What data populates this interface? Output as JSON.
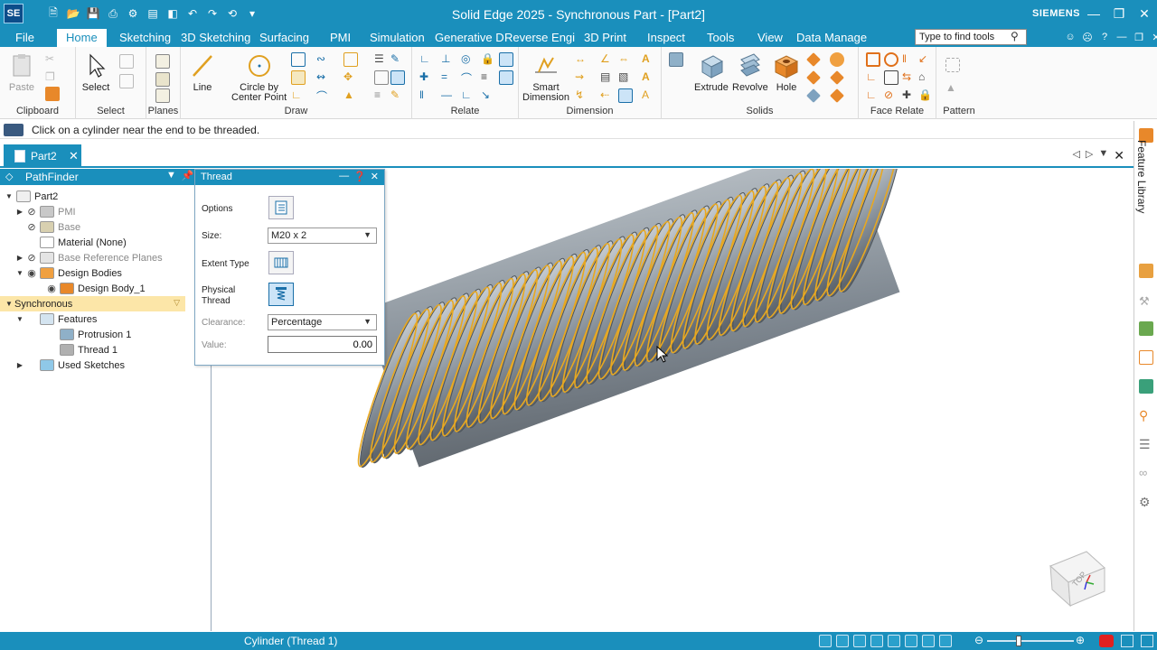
{
  "app": {
    "logo": "SE",
    "title": "Solid Edge 2025 - Synchronous Part - [Part2]",
    "brand": "SIEMENS"
  },
  "menu": {
    "items": [
      {
        "label": "File"
      },
      {
        "label": "Home",
        "active": true
      },
      {
        "label": "Sketching"
      },
      {
        "label": "3D Sketching"
      },
      {
        "label": "Surfacing"
      },
      {
        "label": "PMI"
      },
      {
        "label": "Simulation"
      },
      {
        "label": "Generative D"
      },
      {
        "label": "Reverse Engi"
      },
      {
        "label": "3D Print"
      },
      {
        "label": "Inspect"
      },
      {
        "label": "Tools"
      },
      {
        "label": "View"
      },
      {
        "label": "Data Manage"
      }
    ],
    "search_placeholder": "Type to find tools"
  },
  "ribbon": {
    "groups": {
      "clipboard": "Clipboard",
      "select": "Select",
      "planes": "Planes",
      "draw": "Draw",
      "relate": "Relate",
      "dimension": "Dimension",
      "solids": "Solids",
      "face_relate": "Face Relate",
      "pattern": "Pattern"
    },
    "buttons": {
      "paste": "Paste",
      "select": "Select",
      "line": "Line",
      "circle_line1": "Circle by",
      "circle_line2": "Center Point",
      "smart_dim_line1": "Smart",
      "smart_dim_line2": "Dimension",
      "extrude": "Extrude",
      "revolve": "Revolve",
      "hole": "Hole"
    }
  },
  "prompt": "Click on a cylinder near the end to be threaded.",
  "document_tab": "Part2",
  "pathfinder": {
    "title": "PathFinder",
    "tree": [
      {
        "label": "Part2",
        "level": 0,
        "expander": "open",
        "icon": "part-icon",
        "eye": "none"
      },
      {
        "label": "PMI",
        "level": 1,
        "expander": "closed",
        "icon": "pmi-icon",
        "eye": "hidden",
        "dim": true
      },
      {
        "label": "Base",
        "level": 1,
        "expander": "none",
        "icon": "base-icon",
        "eye": "hidden",
        "dim": true
      },
      {
        "label": "Material (None)",
        "level": 1,
        "expander": "none",
        "icon": "material-icon",
        "eye": "none"
      },
      {
        "label": "Base Reference Planes",
        "level": 1,
        "expander": "closed",
        "icon": "planes-icon",
        "eye": "hidden",
        "dim": true
      },
      {
        "label": "Design Bodies",
        "level": 1,
        "expander": "open",
        "icon": "design-bodies-icon",
        "eye": "visible"
      },
      {
        "label": "Design Body_1",
        "level": 2,
        "expander": "none",
        "icon": "body-icon",
        "eye": "visible"
      },
      {
        "label": "Synchronous",
        "level": 0,
        "expander": "open",
        "icon": "none",
        "eye": "none",
        "highlight": true
      },
      {
        "label": "Features",
        "level": 1,
        "expander": "open",
        "icon": "features-icon",
        "eye": "none"
      },
      {
        "label": "Protrusion 1",
        "level": 2,
        "expander": "none",
        "icon": "protrusion-icon",
        "eye": "none"
      },
      {
        "label": "Thread 1",
        "level": 2,
        "expander": "none",
        "icon": "thread-icon",
        "eye": "none"
      },
      {
        "label": "Used Sketches",
        "level": 1,
        "expander": "closed",
        "icon": "sketches-icon",
        "eye": "none"
      }
    ]
  },
  "thread_dialog": {
    "title": "Thread",
    "options_label": "Options",
    "size_label": "Size:",
    "size_value": "M20 x 2",
    "extent_label": "Extent Type",
    "physical_line1": "Physical",
    "physical_line2": "Thread",
    "clearance_label": "Clearance:",
    "clearance_value": "Percentage",
    "value_label": "Value:",
    "value_value": "0.00"
  },
  "right_sidebar": {
    "label": "Feature Library"
  },
  "view_cube": {
    "face_label": "TOP"
  },
  "status": {
    "text": "Cylinder (Thread 1)"
  },
  "colors": {
    "accent": "#1a8fbc",
    "thread_highlight": "#e8a820",
    "body": "#9aa3ab"
  }
}
